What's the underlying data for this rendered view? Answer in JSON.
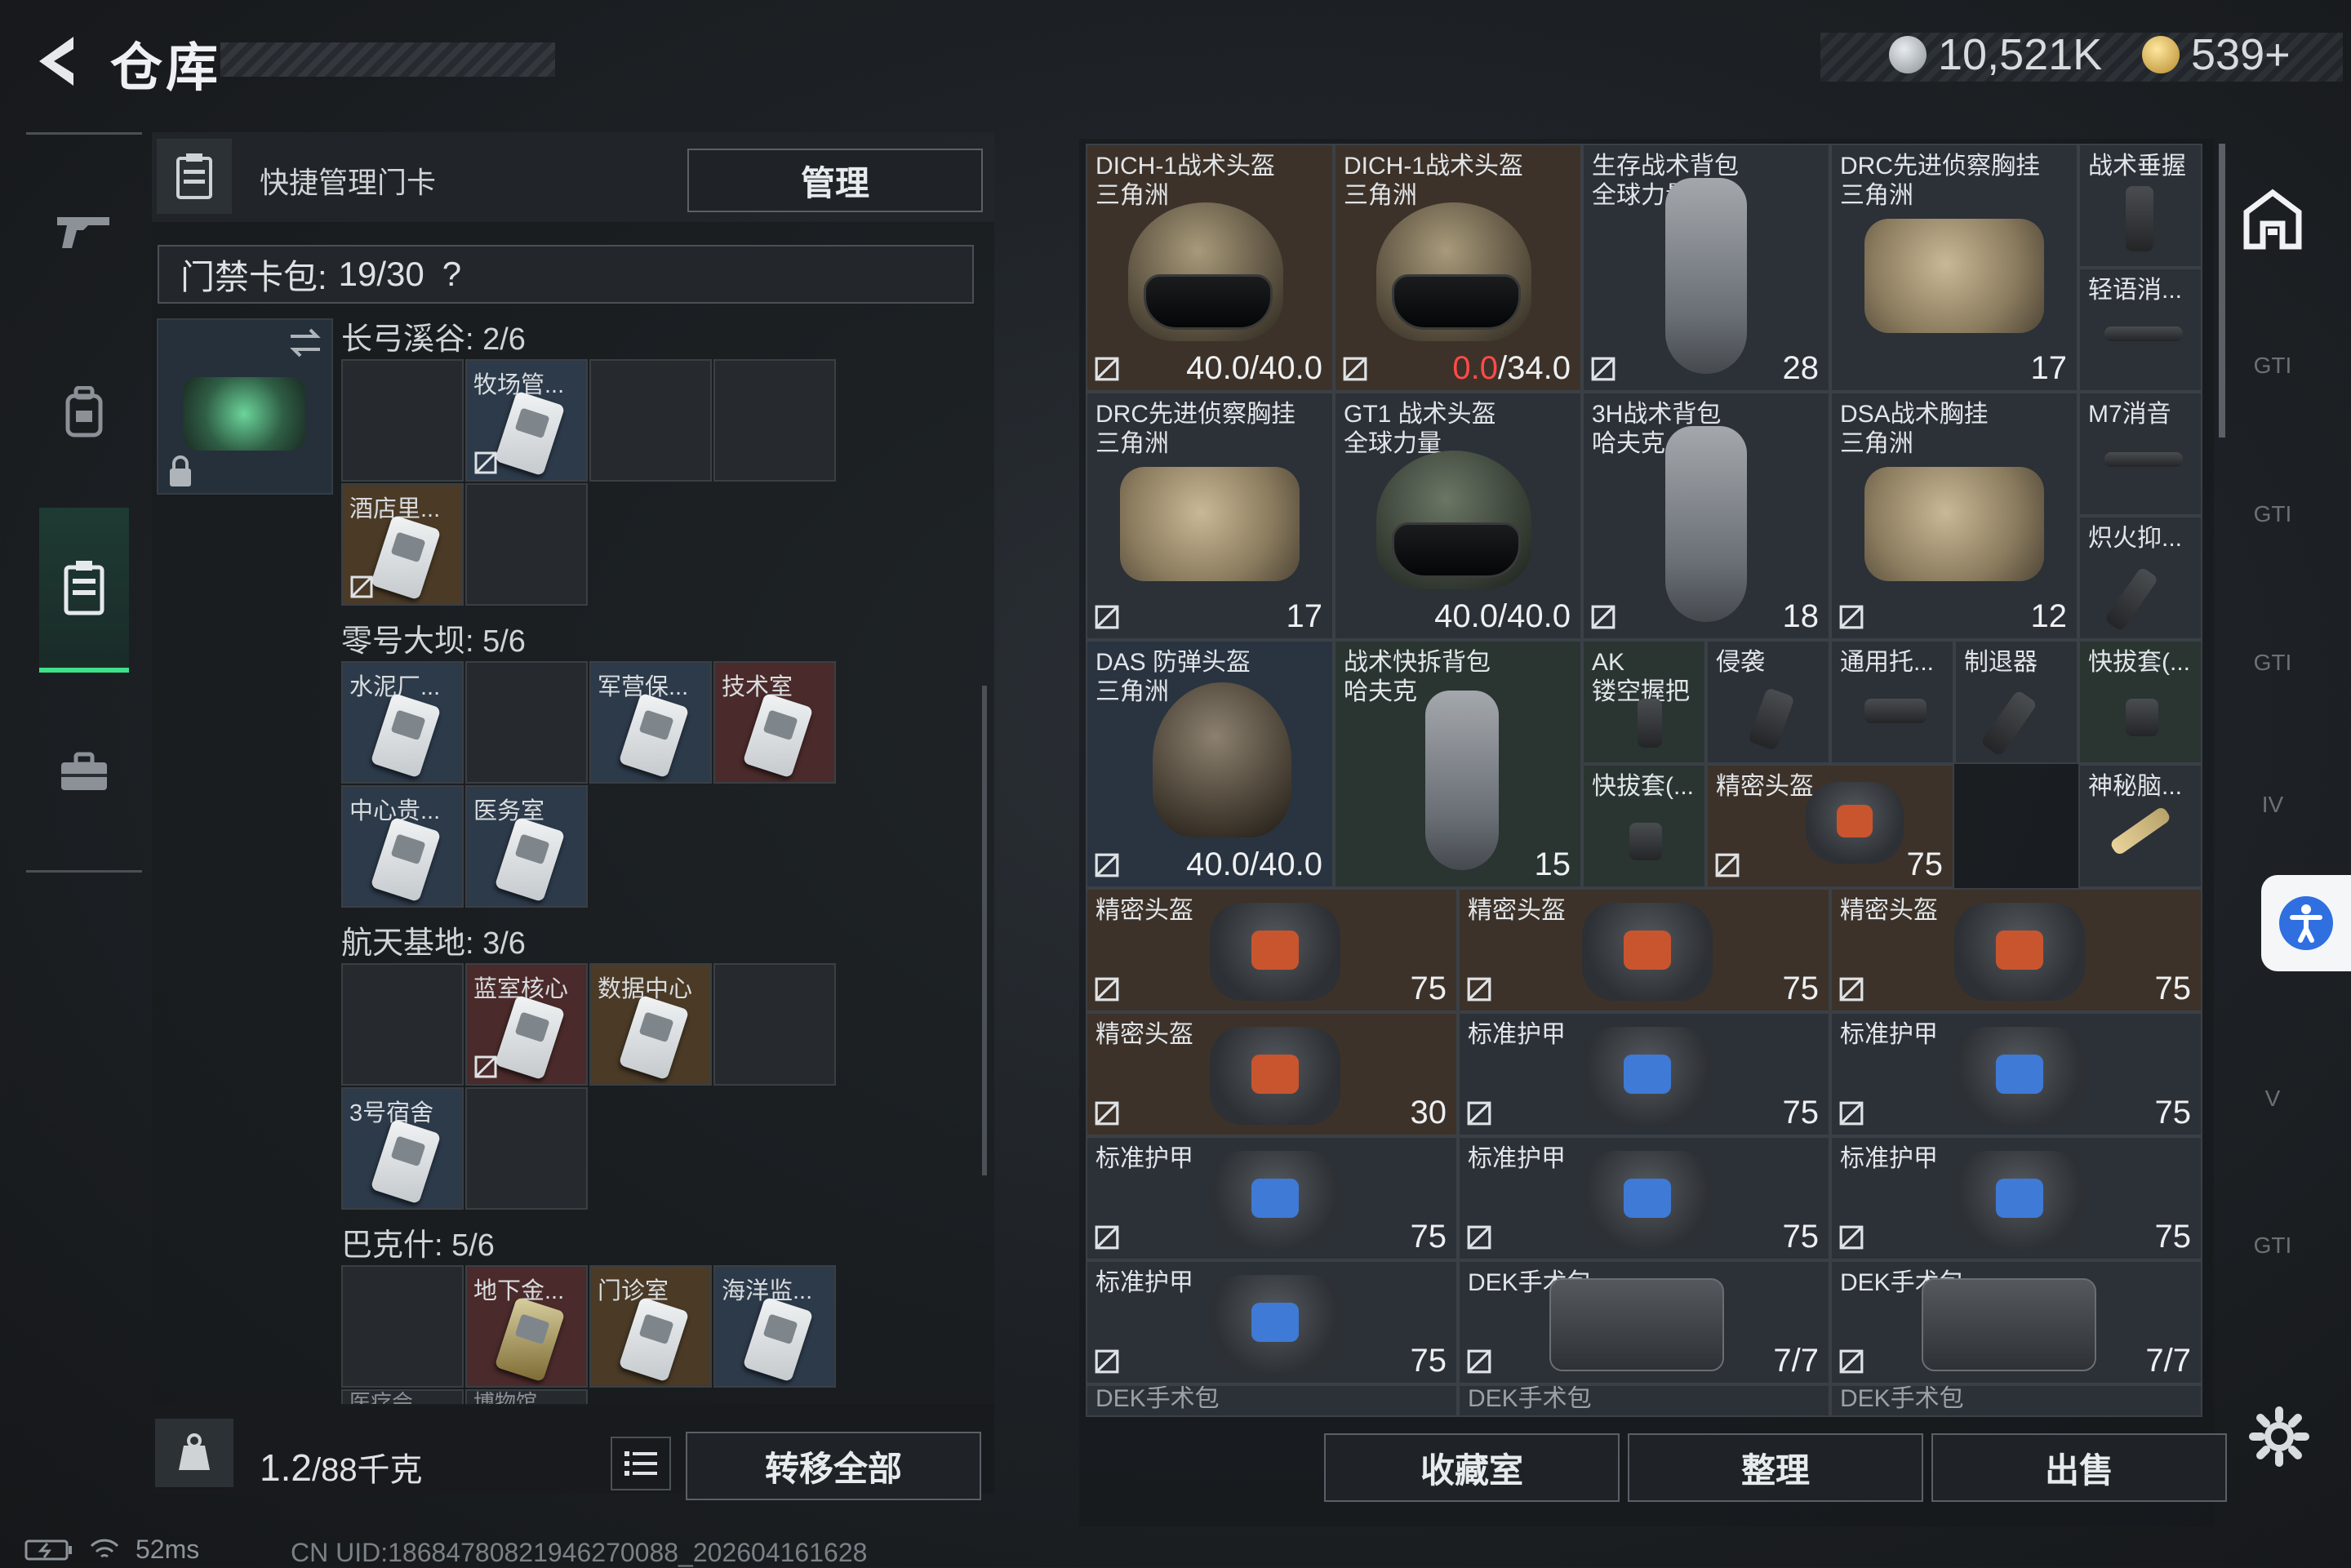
{
  "header": {
    "title": "仓库",
    "currency_silver": "10,521K",
    "currency_gold": "539+"
  },
  "card_panel": {
    "header_title": "快捷管理门卡",
    "manage_label": "管理",
    "capacity_label": "门禁卡包:",
    "capacity_value": "19/30",
    "help_glyph": "?",
    "maps": [
      {
        "title": "长弓溪谷: 2/6",
        "cards": [
          "牧场管...",
          "酒店里..."
        ]
      },
      {
        "title": "零号大坝: 5/6",
        "cards": [
          "水泥厂...",
          "军营保...",
          "技术室",
          "中心贵...",
          "医务室"
        ]
      },
      {
        "title": "航天基地: 3/6",
        "cards": [
          "蓝室核心",
          "数据中心",
          "3号宿舍"
        ]
      },
      {
        "title": "巴克什: 5/6",
        "cards": [
          "地下金...",
          "门诊室",
          "海洋监...",
          "医疗会",
          "博物馆"
        ]
      }
    ],
    "weight_value": "1.2",
    "weight_max": "/88千克",
    "transfer_label": "转移全部"
  },
  "inventory": {
    "items": [
      {
        "name": "DICH-1战术头盔\n三角洲",
        "value": "40.0/40.0"
      },
      {
        "name": "DICH-1战术头盔\n三角洲",
        "value_red": "0.0",
        "value": "/34.0"
      },
      {
        "name": "生存战术背包\n全球力量",
        "value": "28"
      },
      {
        "name": "DRC先进侦察胸挂\n三角洲",
        "value": "17"
      },
      {
        "name": "战术垂握",
        "value": ""
      },
      {
        "name": "轻语消...",
        "value": ""
      },
      {
        "name": "DRC先进侦察胸挂\n三角洲",
        "value": "17"
      },
      {
        "name": "GT1 战术头盔\n全球力量",
        "value": "40.0/40.0"
      },
      {
        "name": "3H战术背包\n哈夫克",
        "value": "18"
      },
      {
        "name": "DSA战术胸挂\n三角洲",
        "value": "12"
      },
      {
        "name": "M7消音",
        "value": ""
      },
      {
        "name": "炽火抑...",
        "value": ""
      },
      {
        "name": "DAS 防弹头盔\n三角洲",
        "value": "40.0/40.0"
      },
      {
        "name": "战术快拆背包\n哈夫克",
        "value": "15"
      },
      {
        "name": "AK\n镂空握把",
        "value": ""
      },
      {
        "name": "侵袭",
        "value": ""
      },
      {
        "name": "通用托...",
        "value": ""
      },
      {
        "name": "制退器",
        "value": ""
      },
      {
        "name": "快拔套(...",
        "value": ""
      },
      {
        "name": "快拔套(...",
        "value": ""
      },
      {
        "name": "精密头盔",
        "value": "75"
      },
      {
        "name": "神秘脑...",
        "value": ""
      },
      {
        "name": "精密头盔",
        "value": "75"
      },
      {
        "name": "精密头盔",
        "value": "75"
      },
      {
        "name": "精密头盔",
        "value": "75"
      },
      {
        "name": "精密头盔",
        "value": "30"
      },
      {
        "name": "标准护甲",
        "value": "75"
      },
      {
        "name": "标准护甲",
        "value": "75"
      },
      {
        "name": "标准护甲",
        "value": "75"
      },
      {
        "name": "标准护甲",
        "value": "75"
      },
      {
        "name": "标准护甲",
        "value": "75"
      },
      {
        "name": "标准护甲",
        "value": "75"
      },
      {
        "name": "DEK手术包",
        "value": "7/7"
      },
      {
        "name": "DEK手术包",
        "value": "7/7"
      },
      {
        "name": "DEK手术包",
        "value": ""
      },
      {
        "name": "DEK手术包",
        "value": ""
      },
      {
        "name": "DEK手术包",
        "value": ""
      }
    ],
    "buttons": {
      "collection": "收藏室",
      "sort": "整理",
      "sell": "出售"
    },
    "rail_labels": [
      "GTI",
      "GTI",
      "GTI",
      "IV",
      "V",
      "GTI"
    ]
  },
  "footer": {
    "ping": "52ms",
    "uid": "CN UID:18684780821946270088_202604161628"
  }
}
